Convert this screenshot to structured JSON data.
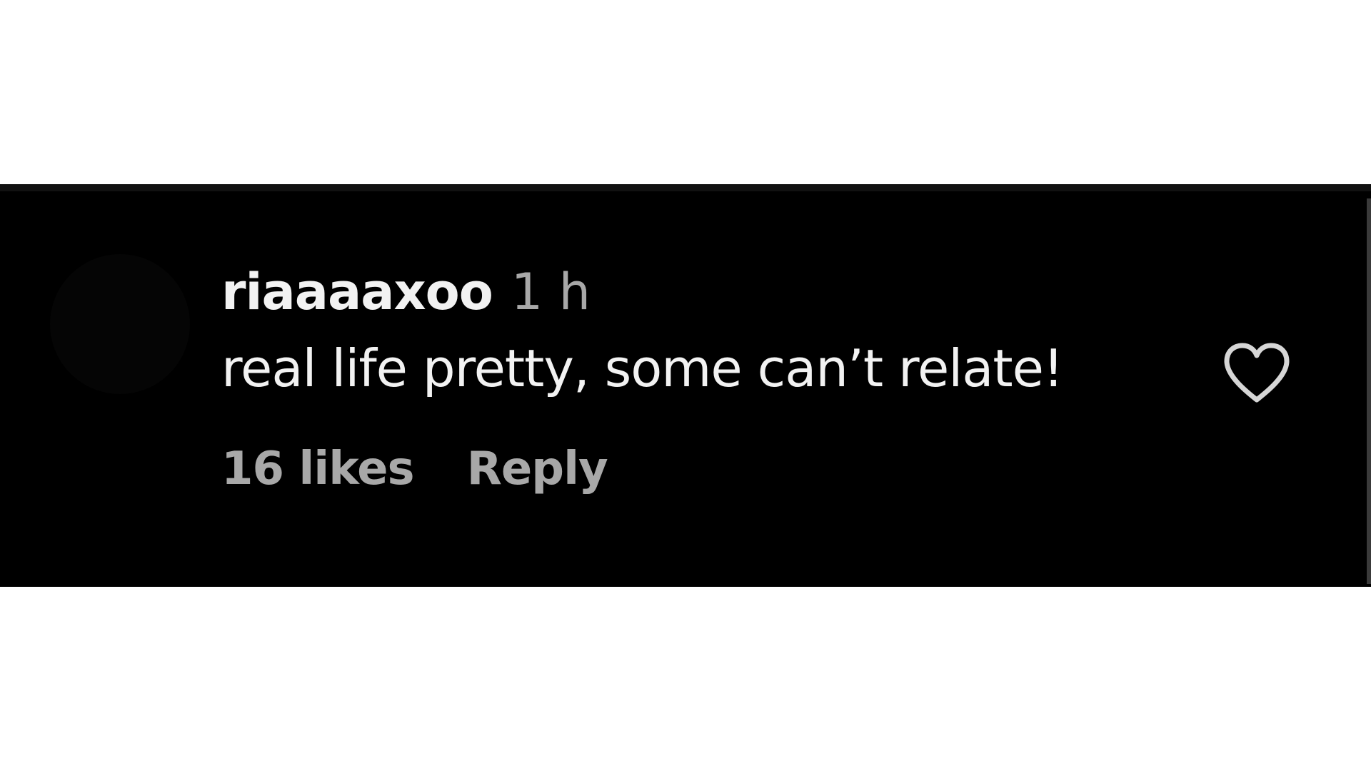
{
  "comment": {
    "username": "riaaaaxoo",
    "timestamp": "1 h",
    "text": "real life pretty, some can’t relate!",
    "likes": "16 likes",
    "reply_label": "Reply"
  },
  "icons": {
    "like": "heart-outline-icon",
    "avatar": "avatar"
  },
  "colors": {
    "panel_background": "#000000",
    "primary_text": "#f2f2f2",
    "secondary_text": "#a8a8a8"
  }
}
